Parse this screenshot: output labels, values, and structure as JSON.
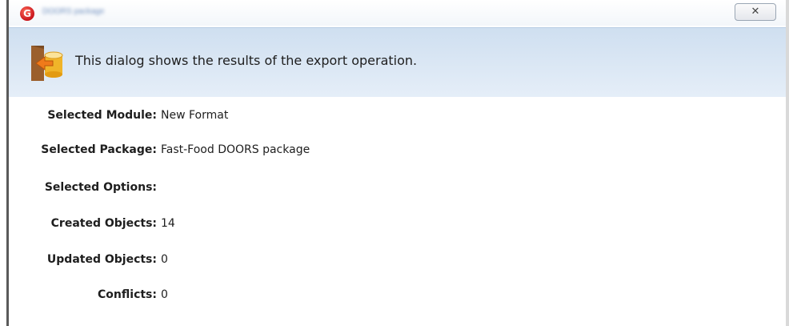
{
  "window": {
    "title": "DOORS package",
    "close_glyph": "✕",
    "logo_letter": "G"
  },
  "header": {
    "message": "This dialog shows the results of the export operation.",
    "icon": "export-door-icon"
  },
  "details": [
    {
      "label": "Selected Module:",
      "value": "New Format"
    },
    {
      "label": "Selected Package:",
      "value": "Fast-Food DOORS package"
    },
    {
      "label": "Selected Options:",
      "value": ""
    },
    {
      "label": "Created Objects:",
      "value": "14"
    },
    {
      "label": "Updated Objects:",
      "value": "0"
    },
    {
      "label": "Conflicts:",
      "value": "0"
    }
  ],
  "colors": {
    "header_band": "#d6e4f3",
    "logo_red": "#c8141b"
  }
}
